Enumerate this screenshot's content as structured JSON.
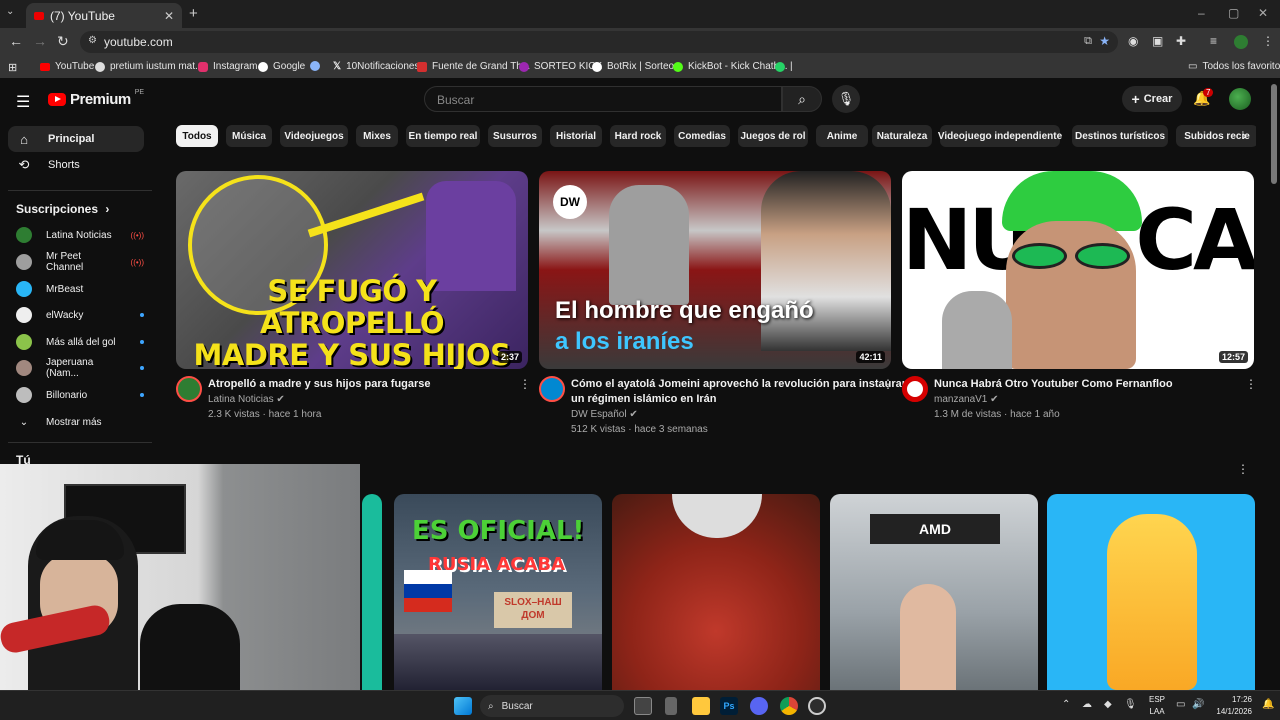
{
  "browser": {
    "tab_title": "(7) YouTube",
    "url": "youtube.com",
    "bookmarks": [
      {
        "label": "YouTube",
        "color": "#ff0000"
      },
      {
        "label": "pretium iustum mat...",
        "color": "#dddddd"
      },
      {
        "label": "Instagram",
        "color": "#e1306c"
      },
      {
        "label": "Google",
        "color": "#4285f4"
      },
      {
        "label": "",
        "color": "#8ab4f8"
      },
      {
        "label": "10Notificaciones",
        "color": "#000000"
      },
      {
        "label": "Fuente de Grand Th...",
        "color": "#d32f2f"
      },
      {
        "label": "SORTEO KICK",
        "color": "#9c27b0"
      },
      {
        "label": "BotRix | Sorteos",
        "color": "#ffffff"
      },
      {
        "label": "KickBot - Kick Chatb...",
        "color": "#53fc18"
      },
      {
        "label": "|",
        "color": "#25d366"
      }
    ],
    "all_favorites": "Todos los favoritos"
  },
  "youtube": {
    "logo_text": "Premium",
    "logo_region": "PE",
    "search_placeholder": "Buscar",
    "create_label": "Crear",
    "notif_count": "7",
    "sidebar": {
      "main": [
        {
          "label": "Principal",
          "icon": "home-icon"
        },
        {
          "label": "Shorts",
          "icon": "shorts-icon"
        }
      ],
      "subs_title": "Suscripciones",
      "subs": [
        {
          "label": "Latina Noticias",
          "status": "live",
          "color": "#2e7d32"
        },
        {
          "label": "Mr Peet Channel",
          "status": "live",
          "color": "#9e9e9e"
        },
        {
          "label": "MrBeast",
          "status": "none",
          "color": "#29b6f6"
        },
        {
          "label": "elWacky",
          "status": "new",
          "color": "#eeeeee"
        },
        {
          "label": "Más allá del gol",
          "status": "new",
          "color": "#8bc34a"
        },
        {
          "label": "Japeruana (Nam...",
          "status": "new",
          "color": "#a1887f"
        },
        {
          "label": "Billonario",
          "status": "new",
          "color": "#bdbdbd"
        }
      ],
      "more_label": "Mostrar más",
      "you_label": "Tú"
    },
    "chips": [
      "Todos",
      "Música",
      "Videojuegos",
      "Mixes",
      "En tiempo real",
      "Susurros",
      "Historial",
      "Hard rock",
      "Comedias",
      "Juegos de rol",
      "Anime",
      "Naturaleza",
      "Videojuego independiente",
      "Destinos turísticos",
      "Subidos recie"
    ],
    "videos": [
      {
        "title_line1": "Atropelló a madre y sus hijos para fugarse",
        "title_line2": "",
        "channel": "Latina Noticias",
        "meta": "2.3 K vistas · hace 1 hora",
        "duration": "2:37",
        "thumb_text1": "SE FUGÓ Y ATROPELLÓ",
        "thumb_text2": "MADRE Y SUS HIJOS"
      },
      {
        "title_line1": "Cómo el ayatolá Jomeini aprovechó la revolución para instaurar",
        "title_line2": "un régimen islámico en Irán",
        "channel": "DW Español",
        "meta": "512 K vistas · hace 3 semanas",
        "duration": "42:11",
        "thumb_text1": "El hombre que engañó",
        "thumb_text2": "a los iraníes",
        "thumb_logo": "DW"
      },
      {
        "title_line1": "Nunca Habrá Otro Youtuber Como Fernanfloo",
        "title_line2": "",
        "channel": "manzanaV1",
        "meta": "1.3 M de vistas · hace 1 año",
        "duration": "12:57",
        "thumb_text1": "NU",
        "thumb_text2": "CA"
      }
    ],
    "row2": {
      "thumb_text1": "ES OFICIAL!",
      "thumb_text2": "RUSIA ACABA",
      "sign1": "SLOX–НАШ",
      "sign2": "ДОМ",
      "store_sign": "AMD"
    }
  },
  "taskbar": {
    "search_label": "Buscar",
    "lang1": "ESP",
    "lang2": "LAA",
    "time": "17:26",
    "date": "14/1/2026"
  }
}
